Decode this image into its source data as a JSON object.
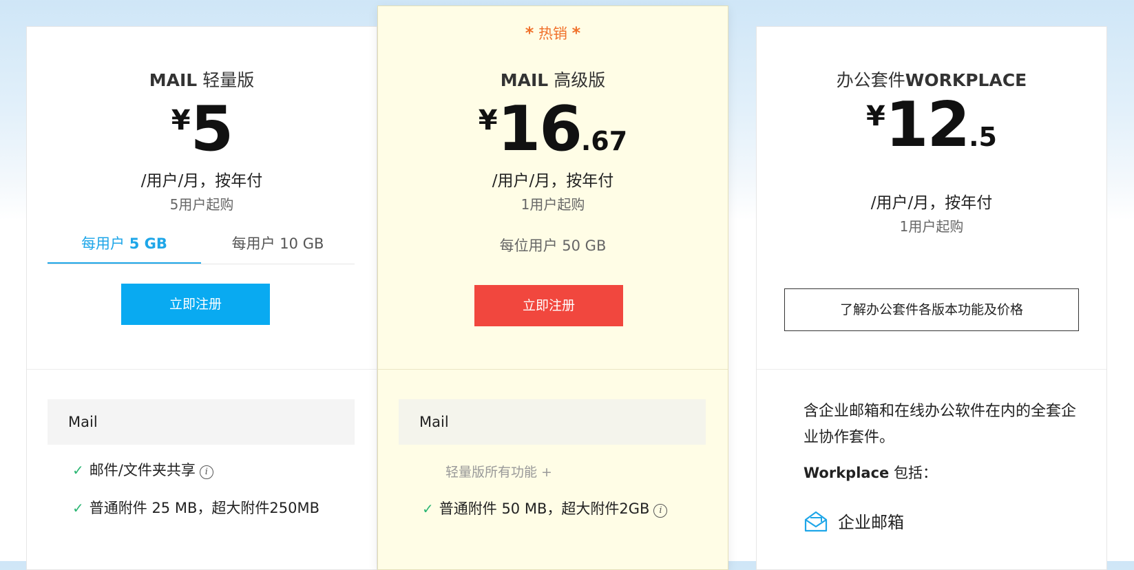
{
  "plans": {
    "lite": {
      "title_bold": "MAIL",
      "title_rest": " 轻量版",
      "currency": "¥",
      "price_int": "5",
      "per_user": "/用户/月，按年付",
      "min_users": "5用户起购",
      "tabs": [
        {
          "prefix": "每用户 ",
          "value": "5 GB",
          "active": true
        },
        {
          "prefix": "每用户 ",
          "value": "10 GB",
          "active": false
        }
      ],
      "signup_label": "立即注册",
      "section_title": "Mail",
      "features": [
        "邮件/文件夹共享",
        "普通附件 25 MB，超大附件250MB"
      ]
    },
    "premium": {
      "hot_star": "*",
      "hot_text": " 热销 ",
      "title_bold": "MAIL",
      "title_rest": " 高级版",
      "currency": "¥",
      "price_int": "16",
      "price_dec": ".67",
      "per_user": "/用户/月，按年付",
      "min_users": "1用户起购",
      "storage": "每位用户 50 GB",
      "signup_label": "立即注册",
      "section_title": "Mail",
      "plus_note": "轻量版所有功能 +",
      "features": [
        "普通附件 50 MB，超大附件2GB"
      ]
    },
    "workplace": {
      "title_rest": "办公套件",
      "title_bold": "WORKPLACE",
      "currency": "¥",
      "price_int": "12",
      "price_dec": ".5",
      "per_user": "/用户/月，按年付",
      "min_users": "1用户起购",
      "compare_label": "了解办公套件各版本功能及价格",
      "description": "含企业邮箱和在线办公软件在内的全套企业协作套件。",
      "includes_bold": "Workplace",
      "includes_rest": " 包括：",
      "included_items": [
        "企业邮箱"
      ]
    }
  },
  "icons": {
    "check": "check-icon",
    "info": "info-icon",
    "mail": "mail-envelope-icon"
  },
  "colors": {
    "hot": "#f0712b",
    "blue_button": "#09aaf1",
    "red_button": "#f1473e",
    "tab_active": "#1ea6e8",
    "check": "#2bb673",
    "premium_bg": "#fffde6"
  }
}
